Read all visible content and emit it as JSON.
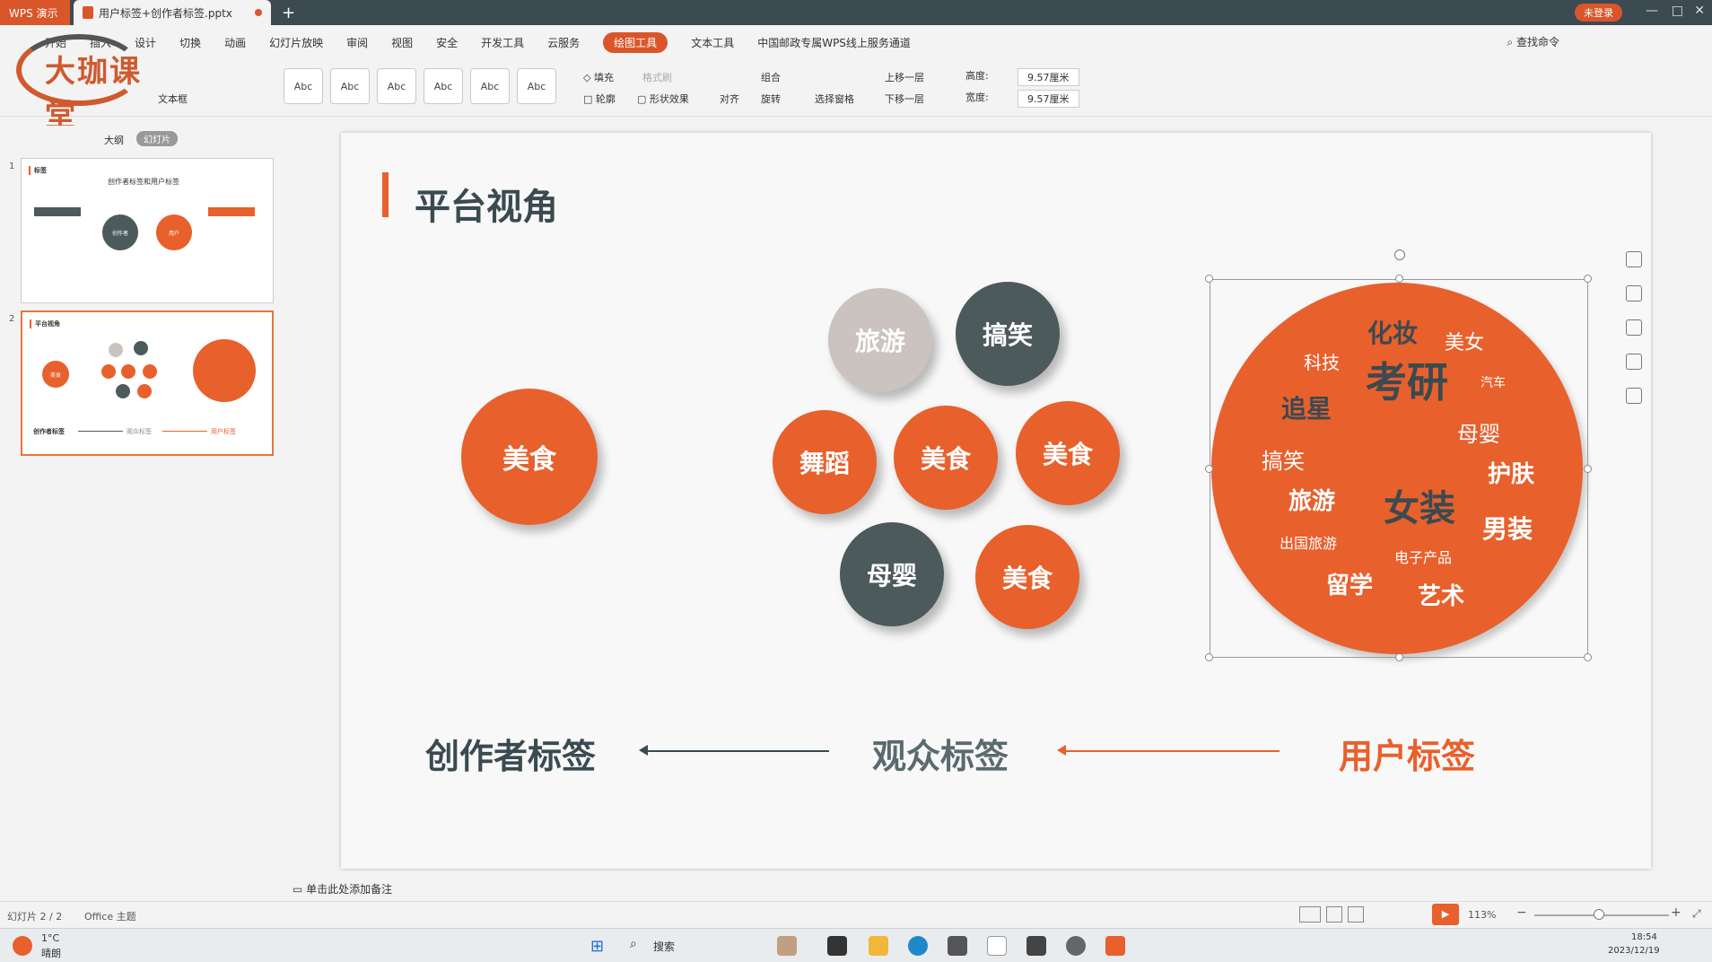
{
  "titlebar": {
    "app_name": "WPS 演示",
    "doc_name": "用户标签+创作者标签.pptx",
    "login": "未登录"
  },
  "menu": {
    "items": [
      "开始",
      "插入",
      "设计",
      "切换",
      "动画",
      "幻灯片放映",
      "审阅",
      "视图",
      "安全",
      "开发工具",
      "云服务",
      "绘图工具",
      "文本工具",
      "中国邮政专属WPS线上服务通道"
    ],
    "active_index": 11,
    "find": "查找命令"
  },
  "logo": {
    "text": "大珈课堂"
  },
  "ribbon": {
    "text_box": "文本框",
    "styles": [
      "Abc",
      "Abc",
      "Abc",
      "Abc",
      "Abc",
      "Abc"
    ],
    "fill": "填充",
    "format_painter": "格式刷",
    "outline": "轮廓",
    "shape_effect": "形状效果",
    "align": "对齐",
    "group": "组合",
    "rotate": "旋转",
    "select_pane": "选择窗格",
    "bring_forward": "上移一层",
    "send_backward": "下移一层",
    "height_label": "高度:",
    "height_value": "9.57厘米",
    "width_label": "宽度:",
    "width_value": "9.57厘米"
  },
  "panel": {
    "outline_tab": "大纲",
    "slides_tab": "幻灯片",
    "thumb1": {
      "num": "1",
      "title": "标签",
      "subtitle": "创作者标签和用户标签",
      "center": "创作者",
      "right": "用户"
    },
    "thumb2": {
      "num": "2",
      "title": "平台视角",
      "left": "美食",
      "bottom_left": "创作者标签",
      "bottom_mid": "观众标签",
      "bottom_right": "用户标签"
    }
  },
  "slide": {
    "title": "平台视角",
    "left_bubble": "美食",
    "cluster": [
      {
        "text": "旅游",
        "style": "light"
      },
      {
        "text": "搞笑",
        "style": "dark"
      },
      {
        "text": "舞蹈",
        "style": "orange"
      },
      {
        "text": "美食",
        "style": "orange"
      },
      {
        "text": "美食",
        "style": "orange"
      },
      {
        "text": "母婴",
        "style": "dark"
      },
      {
        "text": "美食",
        "style": "orange"
      }
    ],
    "word_cloud": [
      "化妆",
      "美女",
      "科技",
      "考研",
      "汽车",
      "追星",
      "母婴",
      "搞笑",
      "护肤",
      "旅游",
      "女装",
      "男装",
      "出国旅游",
      "电子产品",
      "留学",
      "艺术"
    ],
    "labels": {
      "creator": "创作者标签",
      "audience": "观众标签",
      "user": "用户标签"
    }
  },
  "notes_placeholder": "单击此处添加备注",
  "status": {
    "slide_count": "幻灯片 2 / 2",
    "theme": "Office 主题",
    "zoom": "113%"
  },
  "taskbar": {
    "weather_temp": "1°C",
    "weather_desc": "晴朗",
    "search": "搜索",
    "time": "18:54",
    "date": "2023/12/19"
  },
  "colors": {
    "accent": "#e8602c",
    "dark": "#4c5a5c",
    "light": "#cbc3bf"
  }
}
